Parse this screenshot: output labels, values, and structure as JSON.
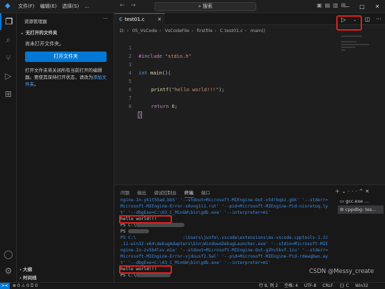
{
  "menu": [
    "文件(F)",
    "编辑(E)",
    "选择(S)",
    "..."
  ],
  "search": {
    "placeholder": "搜索"
  },
  "explorer": {
    "title": "资源管理器",
    "section": "无打开的文件夹",
    "message": "尚未打开文件夹。",
    "open_folder_label": "打开文件夹",
    "desc_1": "打开文件夹将关闭所有当前打开的编辑器。要使其保持打开状态，请改为",
    "desc_link": "添加文件夹",
    "desc_end": "。",
    "outline": "大纲",
    "timeline": "时间线"
  },
  "tab": {
    "icon": "C",
    "label": "test01.c"
  },
  "breadcrumb": [
    "D:",
    "05_VsCode",
    "VsCodeFile",
    "firstfile",
    "C test01.c",
    "main()"
  ],
  "code": {
    "line_numbers": [
      "1",
      "2",
      "3",
      "4",
      "5",
      "6",
      "7",
      "8"
    ],
    "include_kw": "#include",
    "include_str": "\"stdio.h\"",
    "int_kw": "int",
    "main_fn": "main",
    "main_parens": "()",
    "open_brace": "{",
    "printf_fn": "printf",
    "printf_str": "\"hello world!!!\"",
    "printf_end": ");",
    "return_kw": "return",
    "return_val": "0",
    "return_end": ";",
    "close_brace": "}"
  },
  "panel": {
    "tabs": [
      "问题",
      "输出",
      "调试控制台",
      "终端",
      "端口"
    ],
    "active_tab": "终端",
    "terminal_lines": [
      "ngine-In-yk1t55ad.bb5' '--stdout=Microsoft-MIEngine-Out-vtdrbqkz.gbk' '--stderr=",
      "Microsoft-MIEngine-Error-s0vog1i1.rut' '--pid=Microsoft-MIEngine-Pid-nioretoq.ly",
      "t' '--dbgExe=C:\\03_C_MinGW\\bin\\gdb.exe' '--interpreter=mi'",
      "hello world!!!",
      "PS C:\\",
      "PS",
      "PS C:\\                  :\\Users\\junfe\\.vscode\\extensions\\ms-vscode.cpptools-1.22",
      ".11-win32-x64\\debugAdapters\\bin\\WindowsDebugLauncher.exe' '--stdin=Microsoft-MIE",
      "ngine-In-zv5b4lxv.miw' '--stdout=Microsoft-MIEngine-Out-g2hv5kvf.1zu' '--stderr=",
      "Microsoft-MIEngine-Error-vjdousf2.5wl' '--pid=Microsoft-MIEngine-Pid-rdewqbwn.ay",
      "t' '--dbgExe=C:\\03_C_MinGW\\bin\\gdb.exe' '--interpreter=mi'",
      "hello world!!!",
      "PS C:\\"
    ],
    "terminals": [
      "gcc.exe ...",
      "cppdbg: tes..."
    ]
  },
  "status": {
    "remote": "><",
    "errors": "⊗ 0",
    "warnings": "⚠ 0",
    "ports": "⚿ 0",
    "position": "行 8, 列 2",
    "spaces": "空格: 4",
    "encoding": "UTF-8",
    "eol": "CRLF",
    "language": "{} C",
    "platform": "Win32"
  },
  "watermark": "CSDN @Messy_create"
}
